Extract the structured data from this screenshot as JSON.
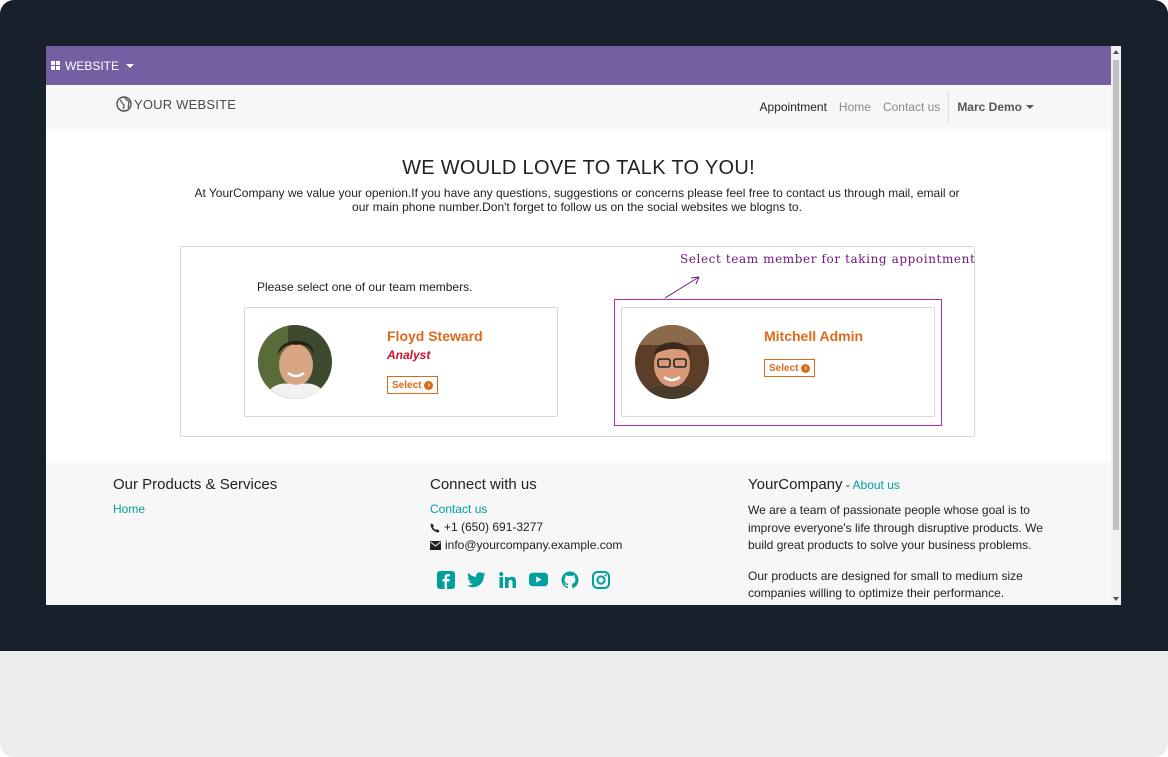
{
  "topbar": {
    "menu_label": "WEBSITE"
  },
  "navbar": {
    "logo_text": "YOUR WEBSITE",
    "links": [
      "Appointment",
      "Home",
      "Contact us"
    ],
    "user": "Marc Demo"
  },
  "hero": {
    "title": "WE WOULD LOVE TO TALK TO YOU!",
    "text": "At YourCompany we value your openion.If you have any questions, suggestions or concerns please feel free to contact us through mail, email or our main phone number.Don't forget to follow us on the social websites we blogns to."
  },
  "team": {
    "prompt": "Please select one of our team members.",
    "annotation": "Select team member for taking appointment",
    "members": [
      {
        "name": "Floyd Steward",
        "role": "Analyst",
        "button": "Select"
      },
      {
        "name": "Mitchell Admin",
        "role": "",
        "button": "Select"
      }
    ]
  },
  "footer": {
    "products": {
      "heading": "Our Products & Services",
      "link": "Home"
    },
    "connect": {
      "heading": "Connect with us",
      "contact_link": "Contact us",
      "phone": "+1 (650) 691-3277",
      "email": "info@yourcompany.example.com"
    },
    "company": {
      "heading": "YourCompany",
      "separator": " - ",
      "about_link": "About us",
      "about_1": "We are a team of passionate people whose goal is to improve everyone's life through disruptive products. We build great products to solve your business problems.",
      "about_2": "Our products are designed for small to medium size companies willing to optimize their performance."
    },
    "social_icons": [
      "facebook-icon",
      "twitter-icon",
      "linkedin-icon",
      "youtube-icon",
      "github-icon",
      "instagram-icon"
    ]
  },
  "colors": {
    "topbar": "#745fa3",
    "accent_orange": "#dc6a1b",
    "role_red": "#c7102f",
    "teal_link": "#00a09d",
    "annotation_purple": "#6f167a"
  }
}
